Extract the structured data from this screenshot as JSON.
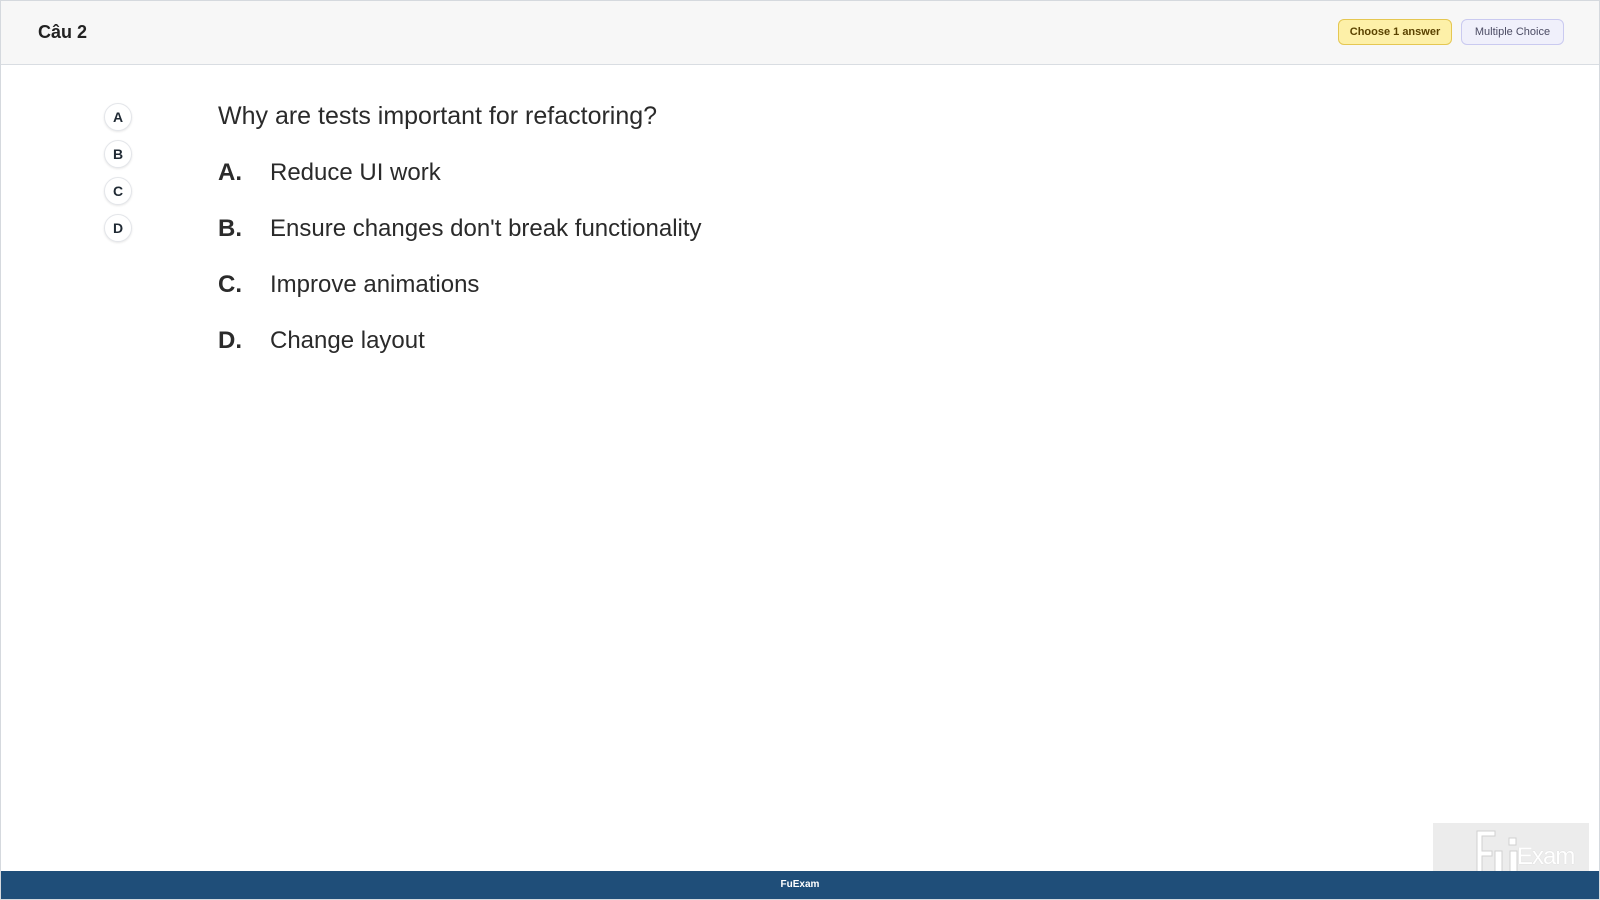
{
  "header": {
    "question_number": "Câu 2",
    "choose_badge": "Choose 1 answer",
    "type_badge": "Multiple Choice"
  },
  "selectors": [
    {
      "label": "A"
    },
    {
      "label": "B"
    },
    {
      "label": "C"
    },
    {
      "label": "D"
    }
  ],
  "question": {
    "text": "Why are tests important for refactoring?",
    "options": [
      {
        "letter": "A.",
        "text": "Reduce UI work"
      },
      {
        "letter": "B.",
        "text": "Ensure changes don't break functionality"
      },
      {
        "letter": "C.",
        "text": "Improve animations"
      },
      {
        "letter": "D.",
        "text": "Change layout"
      }
    ]
  },
  "watermark": {
    "text": "Exam",
    "logo_icon": "fu-logo-icon"
  },
  "footer": {
    "brand": "FuExam"
  },
  "colors": {
    "footer_bg": "#1f4e79",
    "choose_badge_bg": "#fdf0a8",
    "type_badge_bg": "#f0f0fb"
  }
}
